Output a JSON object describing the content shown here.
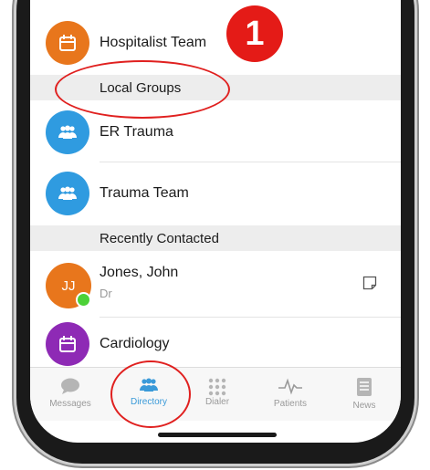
{
  "list": {
    "hospitalist": "Hospitalist Team",
    "local_groups_header": "Local Groups",
    "er_trauma": "ER Trauma",
    "trauma_team": "Trauma Team",
    "recent_header": "Recently Contacted",
    "jones_name": "Jones, John",
    "jones_initials": "JJ",
    "jones_title": "Dr",
    "cardiology": "Cardiology"
  },
  "tabs": [
    {
      "label": "Messages"
    },
    {
      "label": "Directory"
    },
    {
      "label": "Dialer"
    },
    {
      "label": "Patients"
    },
    {
      "label": "News"
    }
  ],
  "annotation": {
    "step": "1"
  },
  "colors": {
    "orange": "#e8761c",
    "blue": "#2f9be0",
    "purple": "#8e2ab5",
    "tab_active": "#3a9ad9",
    "annotation_red": "#e41b17"
  }
}
